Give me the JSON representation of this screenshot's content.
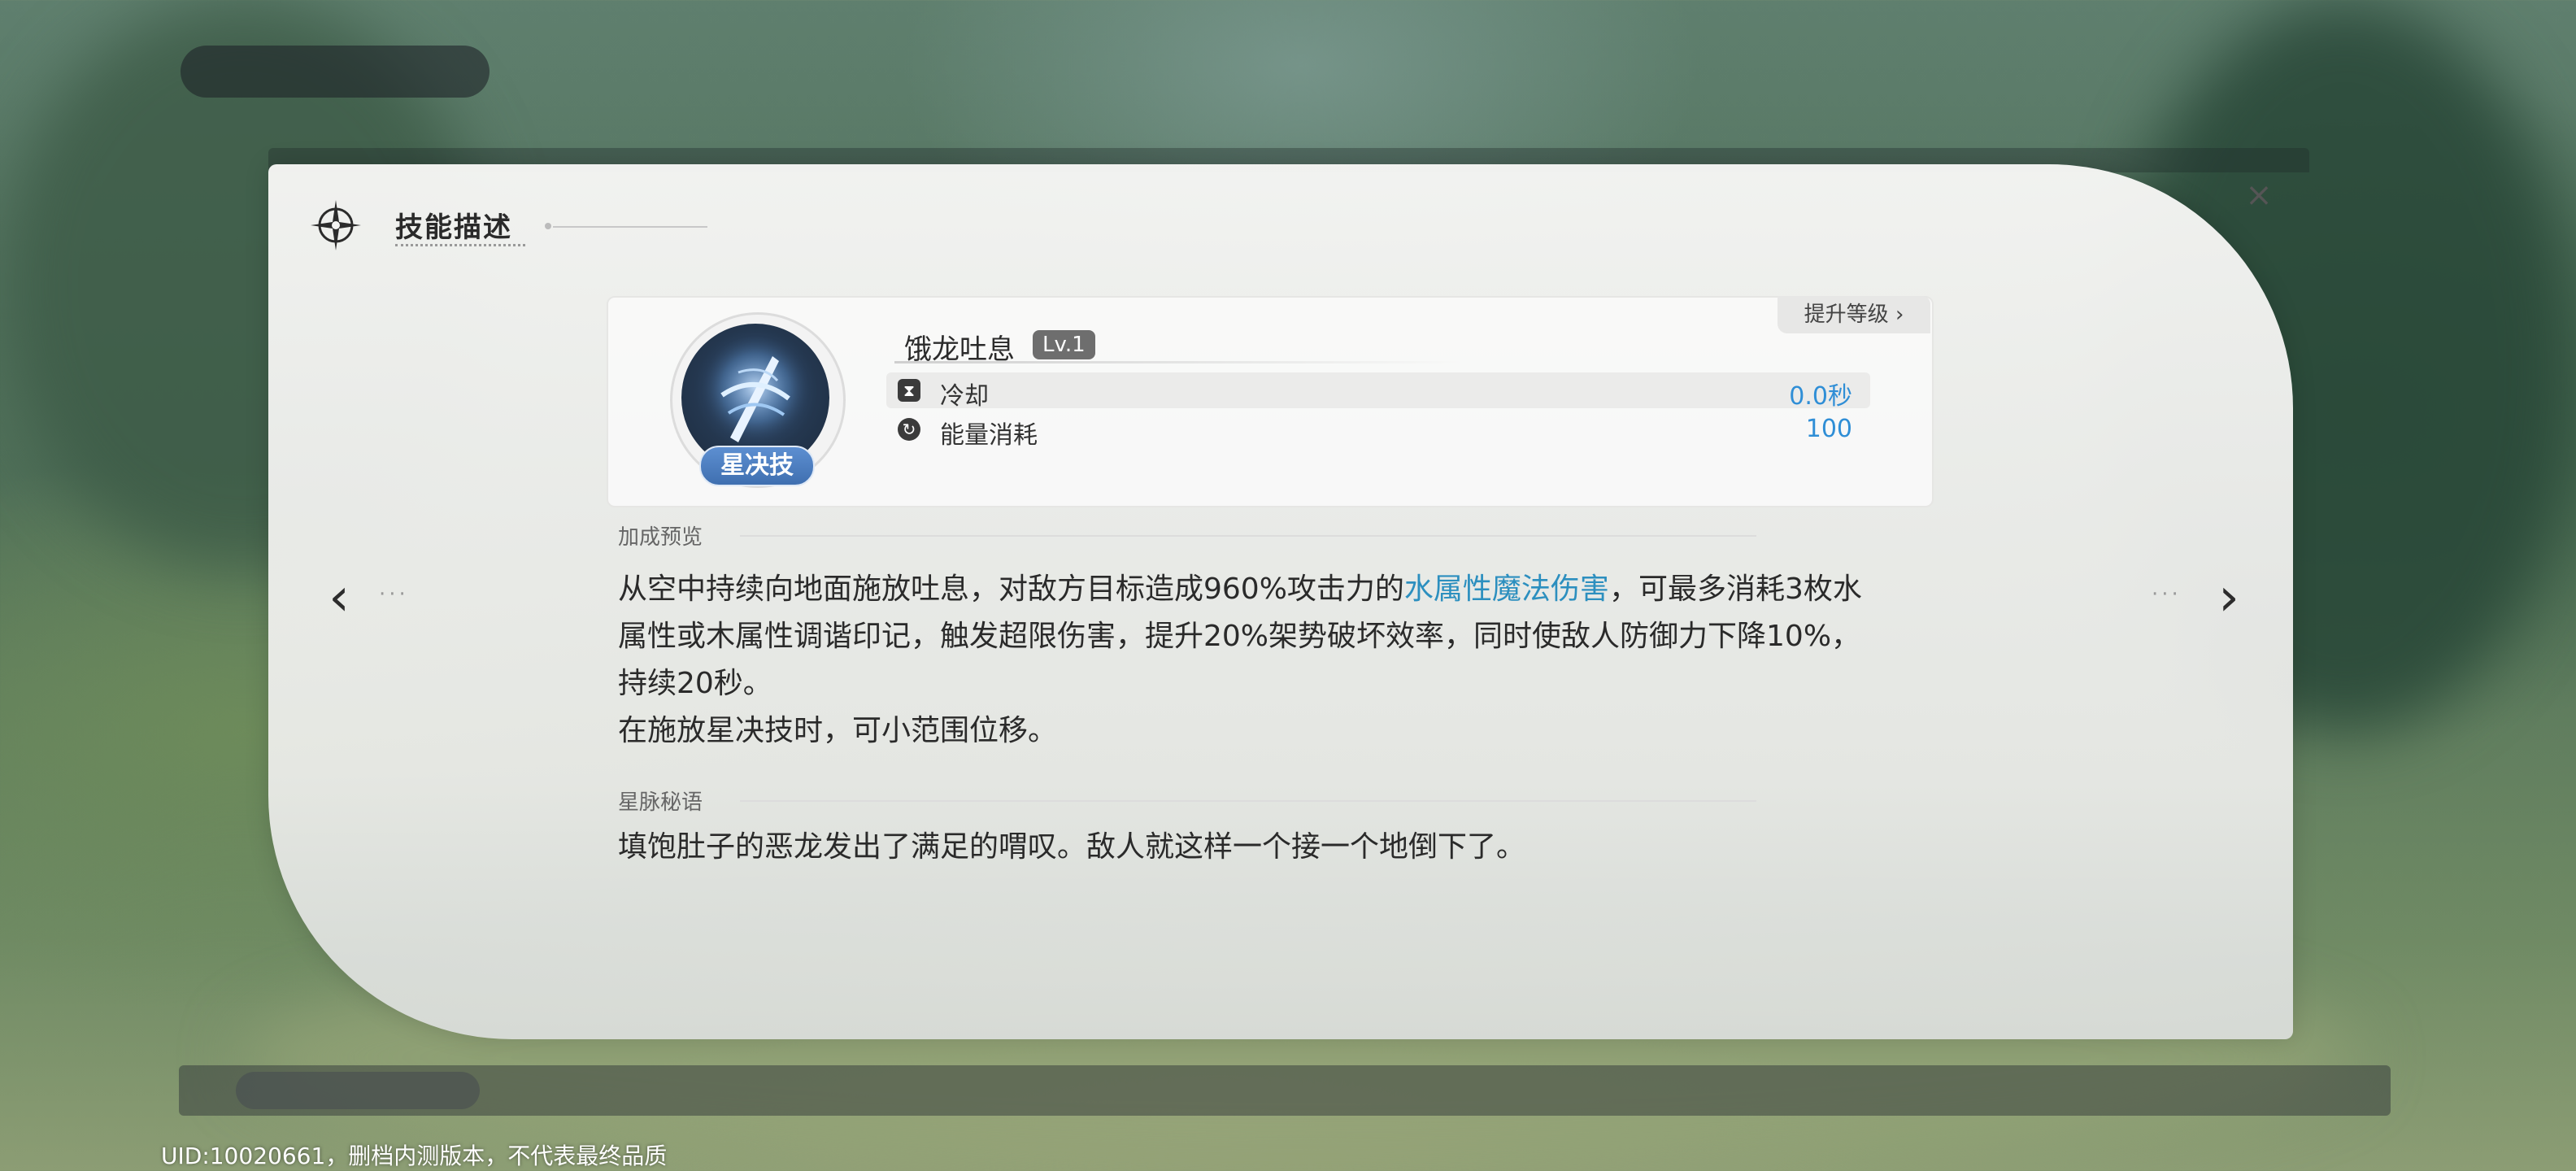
{
  "panel": {
    "title": "技能描述",
    "close_icon": "close-icon"
  },
  "skill": {
    "name": "饿龙吐息",
    "level": "Lv.1",
    "type_tag": "星决技",
    "upgrade_label": "提升等级",
    "stats": [
      {
        "icon": "hourglass-icon",
        "label": "冷却",
        "value": "0.0秒"
      },
      {
        "icon": "energy-icon",
        "label": "能量消耗",
        "value": "100"
      }
    ]
  },
  "bonus": {
    "label": "加成预览",
    "text_part1": "从空中持续向地面施放吐息，对敌方目标造成960%攻击力的",
    "highlight": "水属性魔法伤害",
    "text_part2": "，可最多消耗3枚水属性或木属性调谐印记，触发超限伤害，提升20%架势破坏效率，同时使敌人防御力下降10%，持续20秒。",
    "text_line2": "在施放星决技时，可小范围位移。"
  },
  "lore": {
    "label": "星脉秘语",
    "text": "填饱肚子的恶龙发出了满足的喟叹。敌人就这样一个接一个地倒下了。"
  },
  "nav": {
    "prev_icon": "chevron-left-icon",
    "next_icon": "chevron-right-icon",
    "dots": "···"
  },
  "footer": {
    "uid_text": "UID:10020661，删档内测版本，不代表最终品质"
  },
  "colors": {
    "highlight": "#2c8fbf",
    "stat_value": "#2f8ed6",
    "tag_blue": "#4f7fc2"
  }
}
